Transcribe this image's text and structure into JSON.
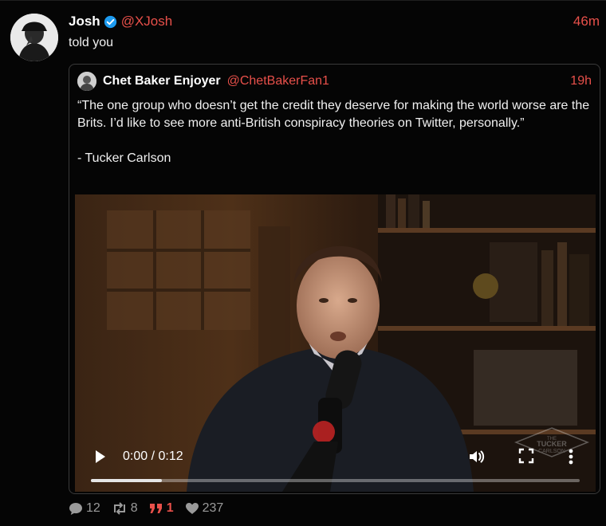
{
  "post": {
    "author_name": "Josh",
    "author_handle": "@XJosh",
    "time": "46m",
    "text": "told you",
    "verified": true
  },
  "quoted_post": {
    "author_name": "Chet Baker Enjoyer",
    "author_handle": "@ChetBakerFan1",
    "time": "19h",
    "text": "“The one group who doesn’t get the credit they deserve for making the world worse are the Brits. I’d like to see more anti-British conspiracy theories on Twitter, personally.”\n\n- Tucker Carlson"
  },
  "video": {
    "time_display": "0:00 / 0:12",
    "progress_fraction": 0.145,
    "watermark": "THE TUCKER CARLSON"
  },
  "actions": {
    "replies": "12",
    "reposts": "8",
    "quotes": "1",
    "likes": "237"
  },
  "colors": {
    "accent": "#e8504a",
    "background": "#050505",
    "muted": "#9a9a9a",
    "verified": "#1d9bf0"
  }
}
